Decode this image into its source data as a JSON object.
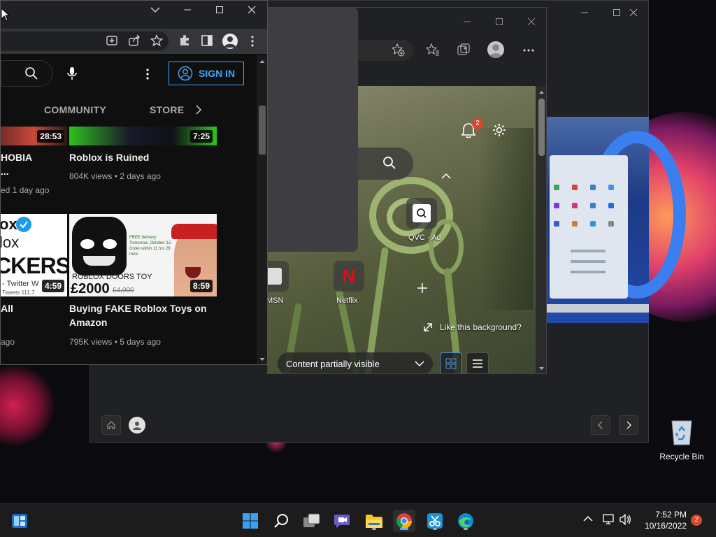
{
  "desktop": {
    "recycle_bin_label": "Recycle Bin"
  },
  "youtube": {
    "sign_in_label": "SIGN IN",
    "tabs": [
      "COMMUNITY",
      "STORE"
    ],
    "videos": [
      {
        "title_line1": "HOBIA",
        "title_line2": "...",
        "meta": "ed 1 day ago",
        "duration": "28:53"
      },
      {
        "title_line1": "Roblox is Ruined",
        "title_line2": "",
        "meta": "804K views • 2 days ago",
        "duration": "7:25"
      },
      {
        "title_line1": "All",
        "title_line2": "",
        "meta": "ago",
        "duration": "4:59"
      },
      {
        "title_line1": "Buying FAKE Roblox Toys on",
        "title_line2": "Amazon",
        "meta": "795K views • 5 days ago",
        "duration": "8:59"
      }
    ],
    "thumb_texts": {
      "t3_line1": "ox",
      "t3_line2": "lox",
      "t3_line3": "CKERS",
      "t3_line4": "- Twitter W",
      "t3_line5": "Tweets   111,7",
      "t4_price": "£2000",
      "t4_old_price": "£4,000",
      "t4_product": "ROBLOX DOORS TOY",
      "t4_delivery": "FREE delivery Tomorrow, October 12. Order within 11 hrs 28 mins"
    }
  },
  "edge": {
    "notification_count": "2",
    "quick_links": [
      {
        "label": "QVC · Ad"
      },
      {
        "label": "MSN"
      },
      {
        "label": "Netflix"
      }
    ],
    "like_background_label": "Like this background?",
    "content_dropdown": "Content partially visible"
  },
  "taskbar": {
    "time": "7:52 PM",
    "date": "10/16/2022",
    "notification_count": "2"
  }
}
